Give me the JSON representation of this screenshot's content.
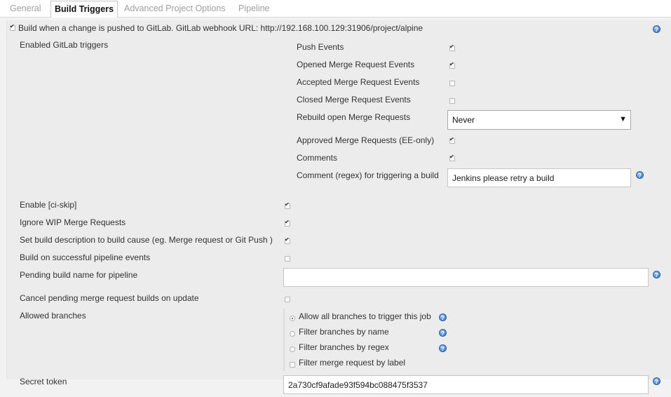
{
  "tabs": [
    "General",
    "Build Triggers",
    "Advanced Project Options",
    "Pipeline"
  ],
  "trigger": {
    "label": "Build when a change is pushed to GitLab. GitLab webhook URL: http://192.168.100.129:31906/project/alpine",
    "checked": true
  },
  "enabled_triggers_label": "Enabled GitLab triggers",
  "gitlab_triggers": [
    {
      "label": "Push Events",
      "checked": true
    },
    {
      "label": "Opened Merge Request Events",
      "checked": true
    },
    {
      "label": "Accepted Merge Request Events",
      "checked": false
    },
    {
      "label": "Closed Merge Request Events",
      "checked": false
    }
  ],
  "rebuild": {
    "label": "Rebuild open Merge Requests",
    "value": "Never"
  },
  "approved": {
    "label": "Approved Merge Requests (EE-only)",
    "checked": true
  },
  "comments": {
    "label": "Comments",
    "checked": true
  },
  "comment_regex": {
    "label": "Comment (regex) for triggering a build",
    "value": "Jenkins please retry a build"
  },
  "options": [
    {
      "label": "Enable [ci-skip]",
      "checked": true
    },
    {
      "label": "Ignore WIP Merge Requests",
      "checked": true
    },
    {
      "label": "Set build description to build cause (eg. Merge request or Git Push )",
      "checked": true
    },
    {
      "label": "Build on successful pipeline events",
      "checked": false
    }
  ],
  "pending_build": {
    "label": "Pending build name for pipeline",
    "value": ""
  },
  "cancel_pending": {
    "label": "Cancel pending merge request builds on update",
    "checked": false
  },
  "allowed_branches": {
    "label": "Allowed branches",
    "choices": [
      {
        "label": "Allow all branches to trigger this job",
        "selected": true
      },
      {
        "label": "Filter branches by name",
        "selected": false
      },
      {
        "label": "Filter branches by regex",
        "selected": false
      }
    ],
    "label_filter": {
      "label": "Filter merge request by label",
      "checked": false
    }
  },
  "secret_token": {
    "label": "Secret token",
    "value": "2a730cf9afade93f594bc088475f3537"
  },
  "help_icon_text": "?"
}
